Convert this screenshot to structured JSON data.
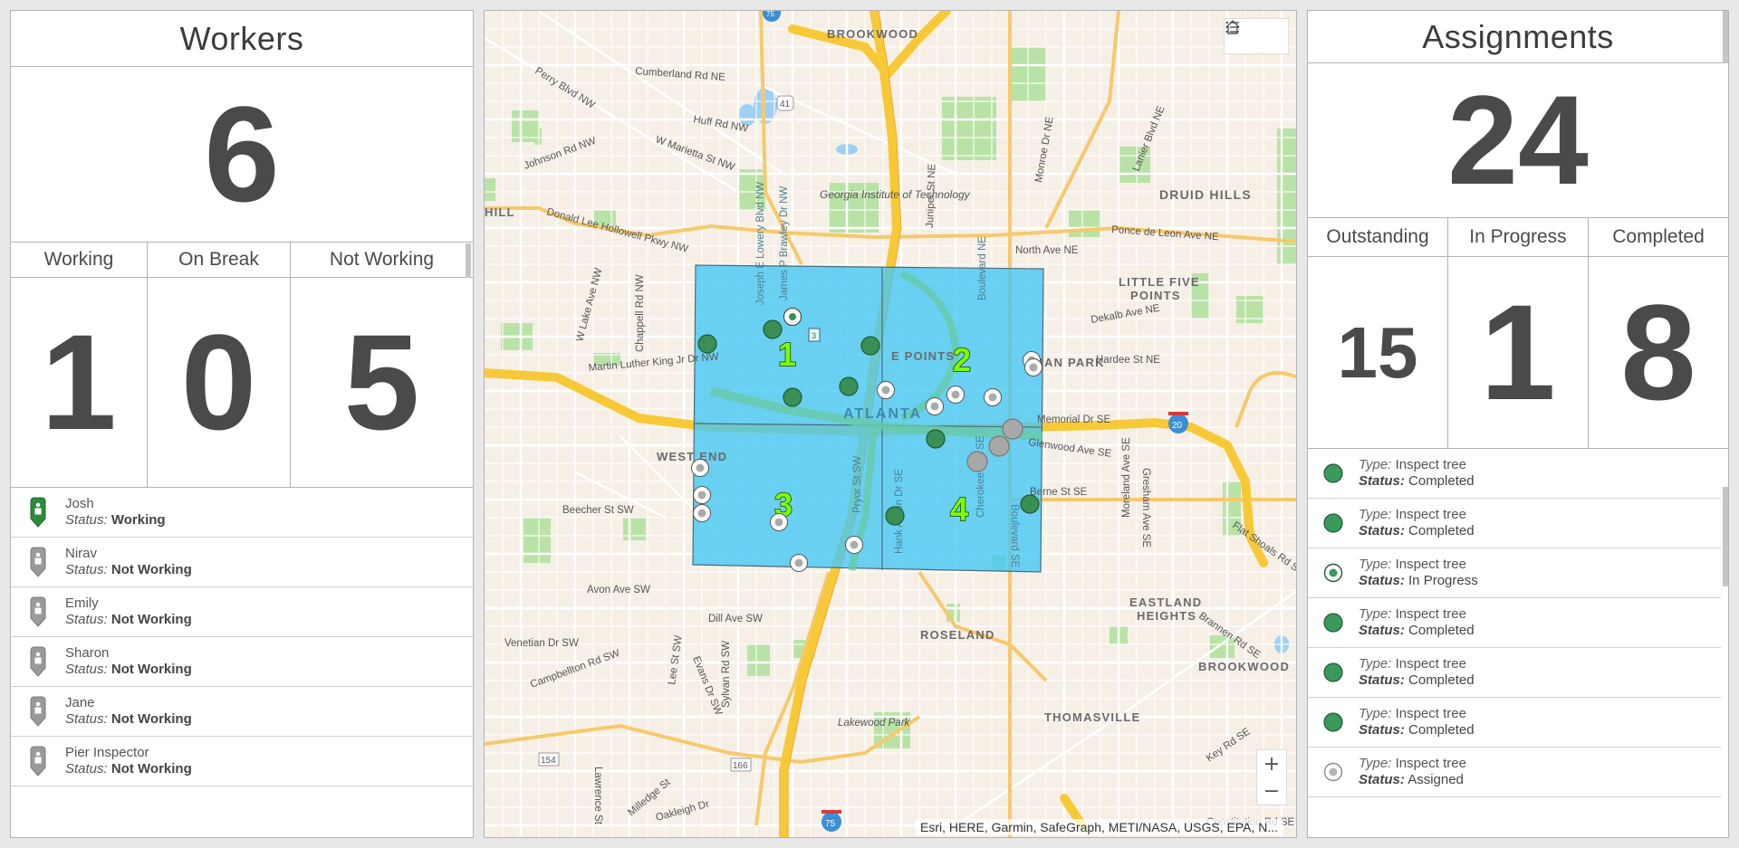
{
  "workers": {
    "title": "Workers",
    "total": "6",
    "columns": [
      {
        "label": "Working",
        "value": "1"
      },
      {
        "label": "On Break",
        "value": "0"
      },
      {
        "label": "Not Working",
        "value": "5"
      }
    ],
    "status_label": "Status:",
    "list": [
      {
        "name": "Josh",
        "status": "Working",
        "color": "#2e8b3d"
      },
      {
        "name": "Nirav",
        "status": "Not Working",
        "color": "#9a9a9a"
      },
      {
        "name": "Emily",
        "status": "Not Working",
        "color": "#9a9a9a"
      },
      {
        "name": "Sharon",
        "status": "Not Working",
        "color": "#9a9a9a"
      },
      {
        "name": "Jane",
        "status": "Not Working",
        "color": "#9a9a9a"
      },
      {
        "name": "Pier Inspector",
        "status": "Not Working",
        "color": "#9a9a9a"
      }
    ]
  },
  "assignments": {
    "title": "Assignments",
    "total": "24",
    "columns": [
      {
        "label": "Outstanding",
        "value": "15"
      },
      {
        "label": "In Progress",
        "value": "1"
      },
      {
        "label": "Completed",
        "value": "8"
      }
    ],
    "type_label": "Type:",
    "status_label": "Status:",
    "list": [
      {
        "type": "Inspect tree",
        "status": "Completed",
        "marker": "completed"
      },
      {
        "type": "Inspect tree",
        "status": "Completed",
        "marker": "completed"
      },
      {
        "type": "Inspect tree",
        "status": "In Progress",
        "marker": "in-progress"
      },
      {
        "type": "Inspect tree",
        "status": "Completed",
        "marker": "completed"
      },
      {
        "type": "Inspect tree",
        "status": "Completed",
        "marker": "completed"
      },
      {
        "type": "Inspect tree",
        "status": "Completed",
        "marker": "completed"
      },
      {
        "type": "Inspect tree",
        "status": "Assigned",
        "marker": "assigned"
      }
    ]
  },
  "map": {
    "attribution": "Esri, HERE, Garmin, SafeGraph, METI/NASA, USGS, EPA, N...",
    "zoom_in": "+",
    "zoom_out": "−",
    "zones": [
      "1",
      "2",
      "3",
      "4"
    ],
    "city_label": "ATLANTA",
    "neighborhoods": [
      "BROOKWOOD",
      "DRUID HILLS",
      "LITTLE FIVE",
      "POINTS",
      "WEST END",
      "ROSELAND",
      "THOMASVILLE",
      "EASTLAND",
      "HEIGHTS",
      "BROOKWOOD",
      "E POINTS",
      "MAN PARK",
      "HILL"
    ],
    "streets": [
      "Perry Blvd NW",
      "Huff Rd NW",
      "W Marietta St NW",
      "Johnson Rd NW",
      "Donald Lee Hollowell Pkwy NW",
      "Cumberland Rd NE",
      "Monroe Dr NE",
      "Lanier Blvd NE",
      "Juniper St NE",
      "Ponce de Leon Ave NE",
      "North Ave NE",
      "Dekalb Ave NE",
      "Hardee St NE",
      "Memorial Dr SE",
      "Glenwood Ave SE",
      "Berne St SE",
      "Moreland Ave SE",
      "Gresham Ave SE",
      "Flat Shoals Rd SE",
      "Martin Luther King Jr Dr NW",
      "W Lake Ave NW",
      "Chappell Rd NW",
      "Beecher St SW",
      "Avon Ave SW",
      "Dill Ave SW",
      "Venetian Dr SW",
      "Campbellton Rd SW",
      "Lee St SW",
      "Evans Dr SW",
      "Sylvan Rd SW",
      "Lawrence St",
      "Milledge St",
      "Oakleigh Dr",
      "Key Rd SE",
      "Constitution Rd SE",
      "Brannen Rd SE",
      "Pryor St SW",
      "Hank Aaron Dr SE",
      "Cherokee Ave SE",
      "Boulevard SE",
      "Joseph E Lowery Blvd NW",
      "James P Brawley Dr NW",
      "Boulevard NE",
      "Georgia Institute of Technology",
      "Lakewood Park"
    ],
    "shields": [
      "41",
      "154",
      "166",
      "20",
      "75",
      "75",
      "3"
    ]
  }
}
